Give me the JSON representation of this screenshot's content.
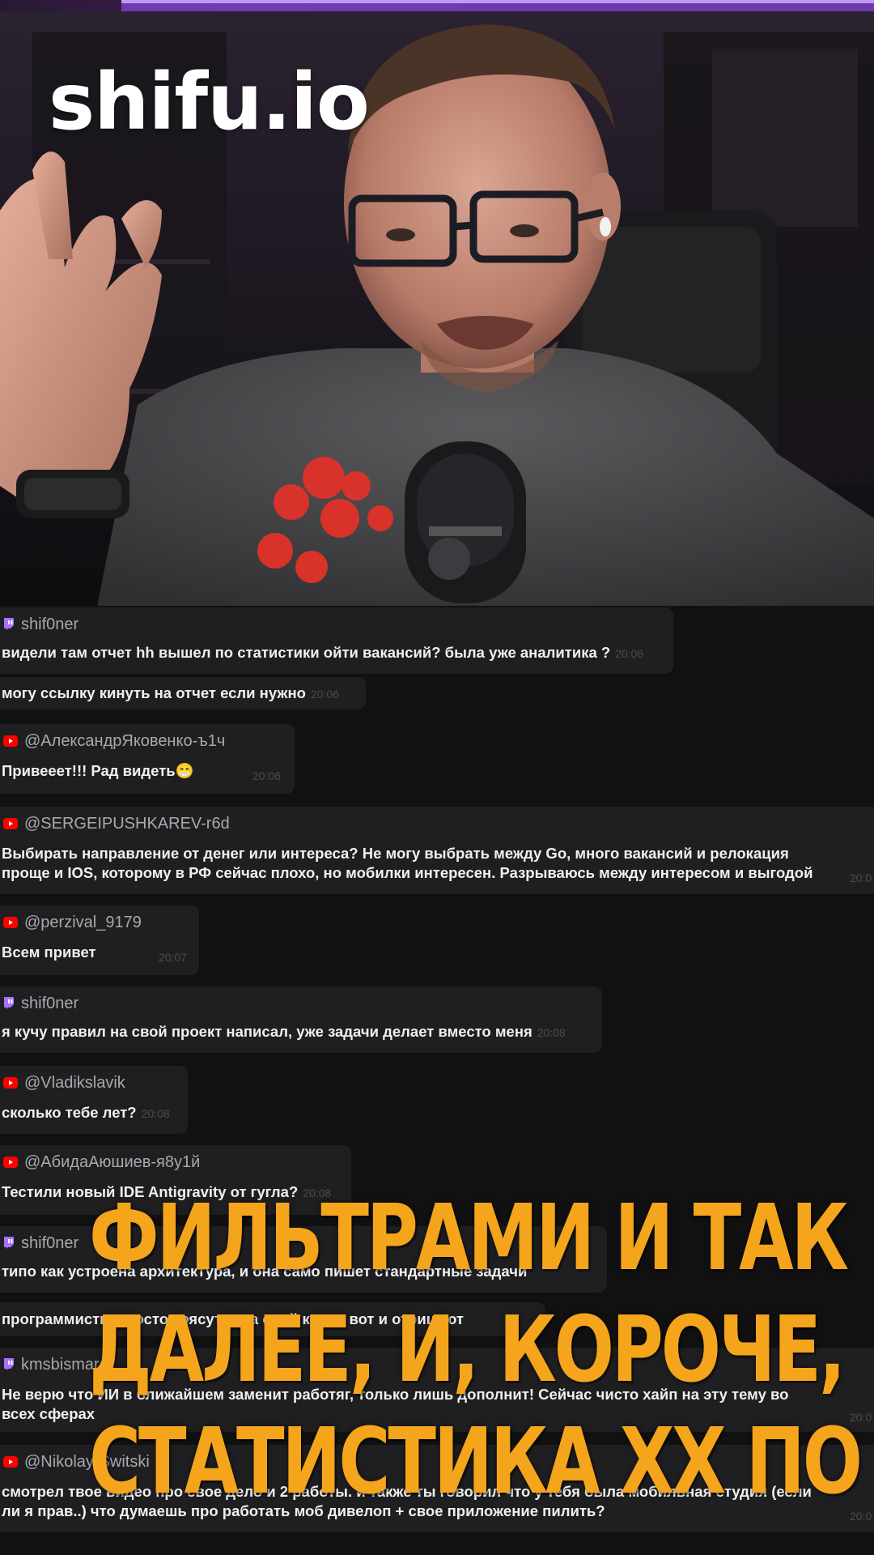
{
  "video": {
    "watermark": "shifu.io"
  },
  "chat": {
    "messages": [
      {
        "platform": "twitch",
        "author": "shif0ner",
        "lines": [
          "видели там отчет hh вышел по статистики ойти вакансий? была уже аналитика ?",
          "могу ссылку кинуть на отчет если нужно"
        ],
        "times": [
          "20:06",
          "20:06"
        ]
      },
      {
        "platform": "youtube",
        "author": "@АлександрЯковенко-ъ1ч",
        "lines": [
          "Привееет!!! Рад видеть😁"
        ],
        "times": [
          "20:06"
        ]
      },
      {
        "platform": "youtube",
        "author": "@SERGEIPUSHKAREV-r6d",
        "lines": [
          "Выбирать направление от денег или интереса? Не могу выбрать между Go, много вакансий и релокация",
          "проще и IOS, которому в РФ сейчас плохо, но мобилки интересен. Разрываюсь между интересом и выгодой"
        ],
        "times": [
          "20:0"
        ]
      },
      {
        "platform": "youtube",
        "author": "@perzival_9179",
        "lines": [
          "Всем привет"
        ],
        "times": [
          "20:07"
        ]
      },
      {
        "platform": "twitch",
        "author": "shif0ner",
        "lines": [
          "я кучу правил на свой проект написал, уже задачи делает вместо меня"
        ],
        "times": [
          "20:08"
        ]
      },
      {
        "platform": "youtube",
        "author": "@Vladikslavik",
        "lines": [
          "сколько тебе лет?"
        ],
        "times": [
          "20:08"
        ]
      },
      {
        "platform": "youtube",
        "author": "@АбидаАюшиев-я8у1й",
        "lines": [
          "Тестили новый IDE Antigravity от гугла?"
        ],
        "times": [
          "20:08"
        ]
      },
      {
        "platform": "twitch",
        "author": "shif0ner",
        "lines": [
          "типо как устроена архитектура, и она само пишет стандартные задачи",
          "программисты просто трясутся за свой коды, вот и отрицают"
        ],
        "times": []
      },
      {
        "platform": "twitch",
        "author": "kmsbismarck",
        "lines": [
          "Не верю что ИИ в ближайшем заменит работяг, только лишь дополнит! Сейчас чисто хайп на эту тему во",
          "всех сферах"
        ],
        "times": [
          "20:0"
        ]
      },
      {
        "platform": "youtube",
        "author": "@Nikolay-Switski",
        "lines": [
          "смотрел твое видео про свое дело и 2 работы. и также ты говорил что у тебя была мобильная студия (если",
          "ли я прав..) что думаешь про работать моб дивелоп + свое приложение пилить?"
        ],
        "times": [
          "20:0"
        ]
      }
    ]
  },
  "subtitle": {
    "lines": [
      "ФИЛЬТРАМИ И ТАК",
      "ДАЛЕЕ, И, КОРОЧЕ,",
      "СТАТИСТИКА ХХ ПО"
    ],
    "color": "#f5a51c"
  },
  "colors": {
    "twitch": "#9146ff",
    "youtube": "#ff0000",
    "chat_bg": "#111112",
    "bubble_bg": "#1f1f21"
  },
  "icons": {
    "twitch": "twitch-icon",
    "youtube": "youtube-icon"
  }
}
